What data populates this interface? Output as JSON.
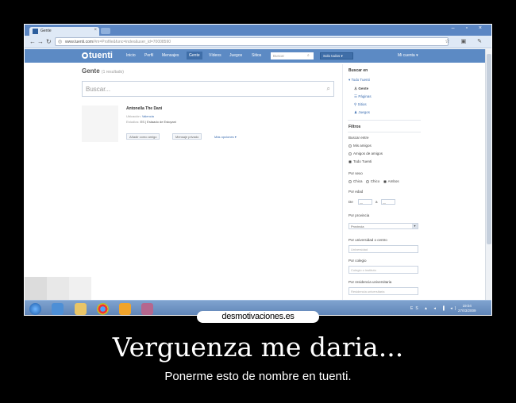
{
  "browser": {
    "tab_title": "Gente",
    "url_host": "www.tuenti.com",
    "url_path": "/#m=Profile&func=index&user_id=70008590",
    "window_controls": "– ▫ ×",
    "toolbar_icons": "☆ ▣ ✎"
  },
  "tuenti": {
    "logo": "tuenti",
    "nav": [
      "Inicio",
      "Perfil",
      "Mensajes",
      "Gente",
      "Vídeos",
      "Juegos",
      "Sitios"
    ],
    "active_nav": "Gente",
    "search_placeholder": "Buscar",
    "select_label": "Solo todos ▾",
    "account": "Mi cuenta ▾"
  },
  "main": {
    "title": "Gente",
    "count": "(1 resultado)",
    "search_placeholder": "Buscar...",
    "result": {
      "name": "Antonella The Dani",
      "location_label": "Ubicación:",
      "location": "Valencia",
      "studies_label": "Estudios:",
      "studies": "ES | Estaado de Estoyani",
      "add_friend": "Añadir como amigo",
      "send_message": "Mensaje privado",
      "more": "Más opciones ▾"
    }
  },
  "sidebar": {
    "search_in": "Buscar en",
    "all_tuenti": "Todo Tuenti",
    "sections": [
      "Gente",
      "Páginas",
      "Sitios",
      "Juegos"
    ],
    "filters": "Filtros",
    "search_among": "Buscar entre",
    "among_options": [
      "Mis amigos",
      "Amigos de amigos",
      "Todo Tuenti"
    ],
    "by_sex": "Por sexo",
    "sex_options": [
      "Chica",
      "Chico",
      "Ambos"
    ],
    "by_age": "Por edad",
    "age_from": "De",
    "age_to": "a",
    "age_dash": "—",
    "by_province": "Por provincia",
    "province_select": "Provincia",
    "by_university": "Por universidad o centro",
    "university_placeholder": "Universidad",
    "by_school": "Por colegio",
    "school_placeholder": "Colegio o instituto",
    "by_residence": "Por residencia universitaria",
    "residence_placeholder": "Residencia universitaria"
  },
  "taskbar": {
    "tray": "ES ▲ ◂ ▐ ◂)",
    "time": "19:04",
    "date": "27/03/2009"
  },
  "watermark": "desmotivaciones.es",
  "caption": {
    "title": "Verguenza me daria...",
    "subtitle": "Ponerme esto de nombre en tuenti."
  },
  "colors": {
    "tuenti_blue": "#5c8ac4",
    "link_blue": "#3a6cb0",
    "background": "#000000"
  }
}
